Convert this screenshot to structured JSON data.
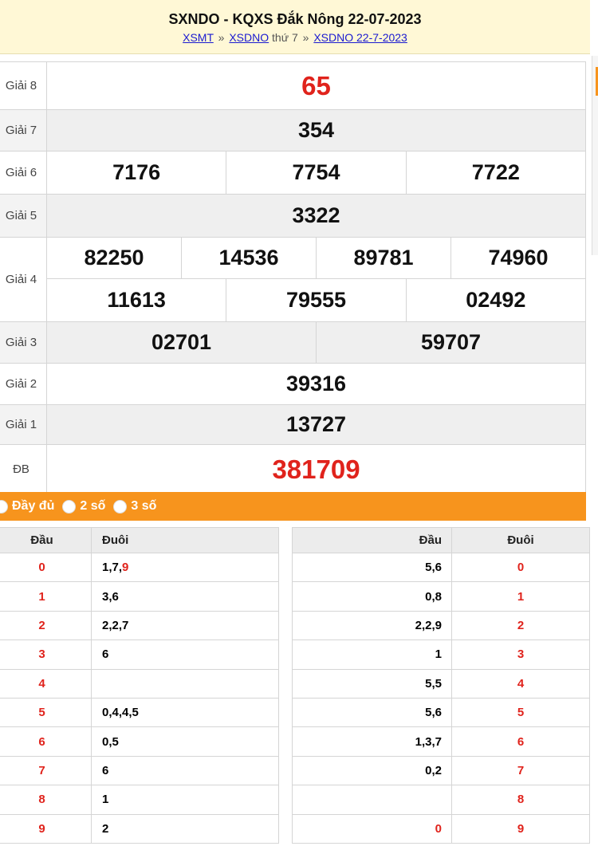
{
  "header": {
    "title": "SXNDO - KQXS Đắk Nông 22-07-2023",
    "crumb_1": "XSMT",
    "sep_1": "»",
    "crumb_2": "XSDNO",
    "crumb_2_suffix": "thứ 7",
    "sep_2": "»",
    "crumb_3": "XSDNO 22-7-2023"
  },
  "prizes": {
    "g8": {
      "label": "Giải 8",
      "numbers": [
        "65"
      ]
    },
    "g7": {
      "label": "Giải 7",
      "numbers": [
        "354"
      ]
    },
    "g6": {
      "label": "Giải 6",
      "numbers": [
        "7176",
        "7754",
        "7722"
      ]
    },
    "g5": {
      "label": "Giải 5",
      "numbers": [
        "3322"
      ]
    },
    "g4": {
      "label": "Giải 4",
      "numbers": [
        "82250",
        "14536",
        "89781",
        "74960",
        "11613",
        "79555",
        "02492"
      ]
    },
    "g3": {
      "label": "Giải 3",
      "numbers": [
        "02701",
        "59707"
      ]
    },
    "g2": {
      "label": "Giải 2",
      "numbers": [
        "39316"
      ]
    },
    "g1": {
      "label": "Giải 1",
      "numbers": [
        "13727"
      ]
    },
    "db": {
      "label": "ĐB",
      "numbers": [
        "381709"
      ]
    }
  },
  "filter": {
    "options": [
      "Đầy đủ",
      "2 số",
      "3 số"
    ]
  },
  "loto_left": {
    "head_col": "Đầu",
    "tail_col": "Đuôi",
    "rows": [
      {
        "head": "0",
        "tail": "1,7,",
        "tail_red": "9"
      },
      {
        "head": "1",
        "tail": "3,6",
        "tail_red": ""
      },
      {
        "head": "2",
        "tail": "2,2,7",
        "tail_red": ""
      },
      {
        "head": "3",
        "tail": "6",
        "tail_red": ""
      },
      {
        "head": "4",
        "tail": "",
        "tail_red": ""
      },
      {
        "head": "5",
        "tail": "0,4,4,5",
        "tail_red": ""
      },
      {
        "head": "6",
        "tail": "0,5",
        "tail_red": ""
      },
      {
        "head": "7",
        "tail": "6",
        "tail_red": ""
      },
      {
        "head": "8",
        "tail": "1",
        "tail_red": ""
      },
      {
        "head": "9",
        "tail": "2",
        "tail_red": ""
      }
    ]
  },
  "loto_right": {
    "head_col": "Đầu",
    "tail_col": "Đuôi",
    "rows": [
      {
        "head": "5,6",
        "head_red": false,
        "tail": "0"
      },
      {
        "head": "0,8",
        "head_red": false,
        "tail": "1"
      },
      {
        "head": "2,2,9",
        "head_red": false,
        "tail": "2"
      },
      {
        "head": "1",
        "head_red": false,
        "tail": "3"
      },
      {
        "head": "5,5",
        "head_red": false,
        "tail": "4"
      },
      {
        "head": "5,6",
        "head_red": false,
        "tail": "5"
      },
      {
        "head": "1,3,7",
        "head_red": false,
        "tail": "6"
      },
      {
        "head": "0,2",
        "head_red": false,
        "tail": "7"
      },
      {
        "head": "",
        "head_red": false,
        "tail": "8"
      },
      {
        "head": "0",
        "head_red": true,
        "tail": "9"
      }
    ]
  },
  "colors": {
    "accent_orange": "#f7941d",
    "red": "#e0231c",
    "header_bg": "#fff8d6",
    "link": "#1a1ad0"
  }
}
